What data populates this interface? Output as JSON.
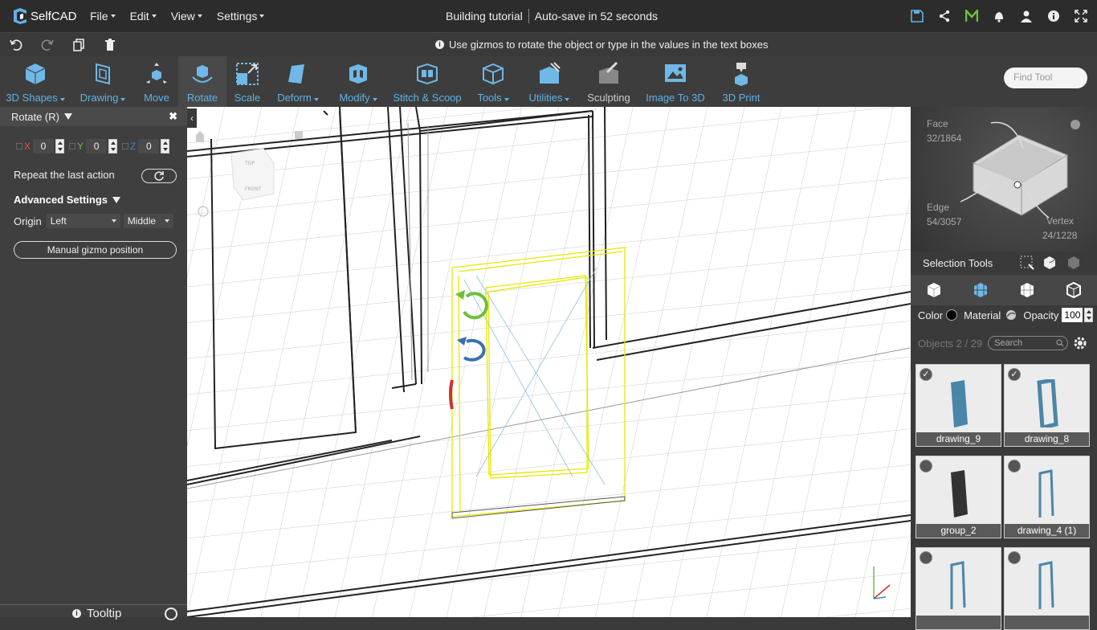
{
  "app": {
    "name": "SelfCAD"
  },
  "menu": {
    "items": [
      "File",
      "Edit",
      "View",
      "Settings"
    ]
  },
  "document": {
    "title": "Building tutorial",
    "autosave": "Auto-save in 52 seconds"
  },
  "hint": {
    "text": "Use gizmos to rotate the object or type in the values in the text boxes"
  },
  "tools": [
    {
      "label": "3D Shapes",
      "dropdown": true
    },
    {
      "label": "Drawing",
      "dropdown": true
    },
    {
      "label": "Move",
      "dropdown": false
    },
    {
      "label": "Rotate",
      "dropdown": false
    },
    {
      "label": "Scale",
      "dropdown": false
    },
    {
      "label": "Deform",
      "dropdown": true
    },
    {
      "label": "Modify",
      "dropdown": true
    },
    {
      "label": "Stitch & Scoop",
      "dropdown": false
    },
    {
      "label": "Tools",
      "dropdown": true
    },
    {
      "label": "Utilities",
      "dropdown": true
    },
    {
      "label": "Sculpting",
      "dropdown": false
    },
    {
      "label": "Image To 3D",
      "dropdown": false
    },
    {
      "label": "3D Print",
      "dropdown": false
    }
  ],
  "find_tool": {
    "placeholder": "Find Tool"
  },
  "rotate_panel": {
    "title": "Rotate (R)",
    "axes": [
      {
        "label": "X",
        "value": "0",
        "color": "#e05050"
      },
      {
        "label": "Y",
        "value": "0",
        "color": "#6fbf3a"
      },
      {
        "label": "Z",
        "value": "0",
        "color": "#3b86d6"
      }
    ],
    "repeat_label": "Repeat the last action",
    "advanced_label": "Advanced Settings",
    "origin_label": "Origin",
    "origin_x": "Left",
    "origin_y": "Middle",
    "gizmo_button": "Manual gizmo position"
  },
  "tooltip": {
    "label": "Tooltip"
  },
  "selection_preview": {
    "face_label": "Face",
    "face_count": "32/1864",
    "edge_label": "Edge",
    "edge_count": "54/3057",
    "vertex_label": "Vertex",
    "vertex_count": "24/1228"
  },
  "selection_tools": {
    "label": "Selection Tools"
  },
  "properties": {
    "color_label": "Color",
    "material_label": "Material",
    "opacity_label": "Opacity",
    "opacity_value": "100"
  },
  "objects": {
    "count": "Objects 2 / 29",
    "search_placeholder": "Search",
    "items": [
      {
        "name": "drawing_9",
        "checked": true
      },
      {
        "name": "drawing_8",
        "checked": true
      },
      {
        "name": "group_2",
        "checked": false
      },
      {
        "name": "drawing_4 (1)",
        "checked": false
      },
      {
        "name": "",
        "checked": false
      },
      {
        "name": "",
        "checked": false
      }
    ]
  },
  "colors": {
    "accent": "#5fb2e6",
    "selection": "#e8e800",
    "gizmo_green": "#6fbf3a",
    "gizmo_blue": "#3b6fb0",
    "gizmo_red": "#d03030"
  }
}
